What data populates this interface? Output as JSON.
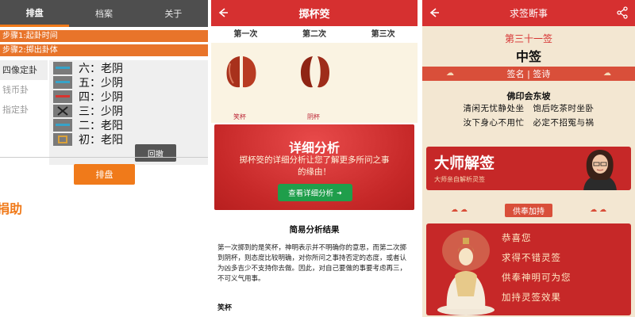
{
  "panel1": {
    "tabs": [
      "排盘",
      "档案",
      "关于"
    ],
    "steps": [
      "步骤1:起卦时间",
      "步骤2:掷出卦体"
    ],
    "side_items": [
      "四像定卦",
      "钱币卦",
      "指定卦"
    ],
    "yao": [
      {
        "label": "六：老阴",
        "icon": "line-icon"
      },
      {
        "label": "五：少阴",
        "icon": "line-icon"
      },
      {
        "label": "四：少阴",
        "icon": "broken-line-icon"
      },
      {
        "label": "三：少阴",
        "icon": "cross-icon"
      },
      {
        "label": "二：老阳",
        "icon": "line-icon"
      },
      {
        "label": "初：老阳",
        "icon": "square-icon"
      }
    ],
    "undo_label": "回撤",
    "paipan_label": "排盘",
    "donate_text": "捐助",
    "accent_color": "#f07a1a"
  },
  "panel2": {
    "title": "掷杯筊",
    "tabs": [
      "第一次",
      "第二次",
      "第三次"
    ],
    "cups": [
      {
        "label": "笑杯"
      },
      {
        "label": "阴杯"
      }
    ],
    "promo": {
      "title": "详细分析",
      "desc": "掷杯筊的详细分析让您了解更多所问之事的缘由！",
      "button_label": "查看详细分析"
    },
    "simple_title": "简易分析结果",
    "simple_text": "第一次掷到的是笑杯，神明表示并不明确你的意思，而第二次掷到阴杯，则态度比较明确，对你所问之事持否定的态度，或者认为凶多吉少不支持你去做。因此，对自己要做的事要考虑再三，不可义气用事。",
    "simple_sub": "笑杯",
    "header_color": "#d63030"
  },
  "panel3": {
    "title": "求签断事",
    "sign_number": "第三十一签",
    "sign_level": "中签",
    "poem_bar": "签名 | 签诗",
    "poem_title": "佛印会东坡",
    "poem_lines": [
      "清闲无忧静处坐　饱后吃茶时坐卧",
      "汝下身心不用忙　必定不招冤与祸"
    ],
    "master_title": "大师解签",
    "master_sub": "大师亲自解析灵签",
    "offer_bar": "供奉加持",
    "offer_lines": [
      "恭喜您",
      "求得不错灵签",
      "供奉神明可为您",
      "加持灵签效果"
    ],
    "header_color": "#d63030"
  }
}
